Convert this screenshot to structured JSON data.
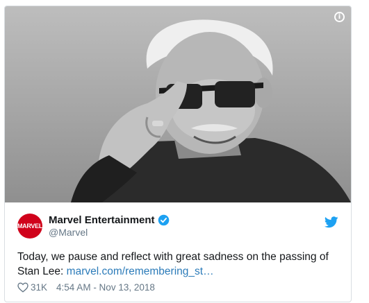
{
  "media": {
    "info_icon": "info-icon",
    "image": "portrait-photo"
  },
  "author": {
    "avatar_text": "MARVEL",
    "display_name": "Marvel Entertainment",
    "handle": "@Marvel",
    "verified": true
  },
  "tweet": {
    "text": "Today, we pause and reflect with great sadness on the passing of Stan Lee: ",
    "link_text": "marvel.com/remembering_st…"
  },
  "meta": {
    "likes": "31K",
    "timestamp": "4:54 AM - Nov 13, 2018"
  },
  "colors": {
    "brand_red": "#d0021b",
    "twitter_blue": "#1da1f2",
    "link_blue": "#2b7bb9",
    "meta_gray": "#657786"
  }
}
